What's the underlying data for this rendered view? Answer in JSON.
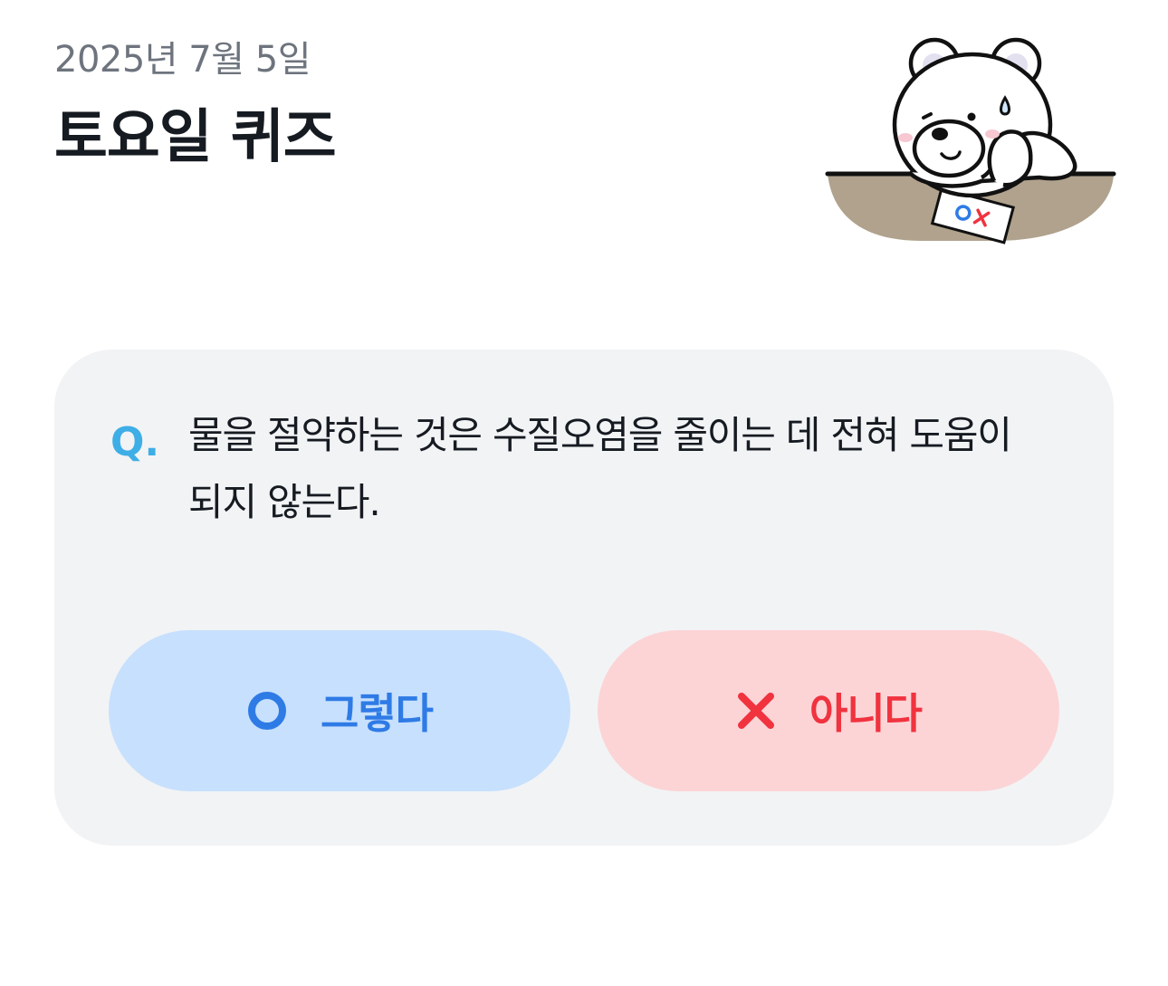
{
  "header": {
    "date": "2025년 7월 5일",
    "title": "토요일 퀴즈",
    "mascot_icon": "polar-bear-thinking-ox-quiz-icon"
  },
  "quiz": {
    "q_label": "Q.",
    "question": "물을 절약하는 것은 수질오염을 줄이는 데 전혀 도움이 되지 않는다.",
    "answers": [
      {
        "label": "그렇다",
        "icon": "circle-o-icon",
        "color": "#2f7be6",
        "background": "#c7e0fd"
      },
      {
        "label": "아니다",
        "icon": "x-mark-icon",
        "color": "#f0333f",
        "background": "#fcd4d6"
      }
    ]
  },
  "colors": {
    "q_accent": "#3eaee6",
    "card_background": "#f2f3f5"
  }
}
